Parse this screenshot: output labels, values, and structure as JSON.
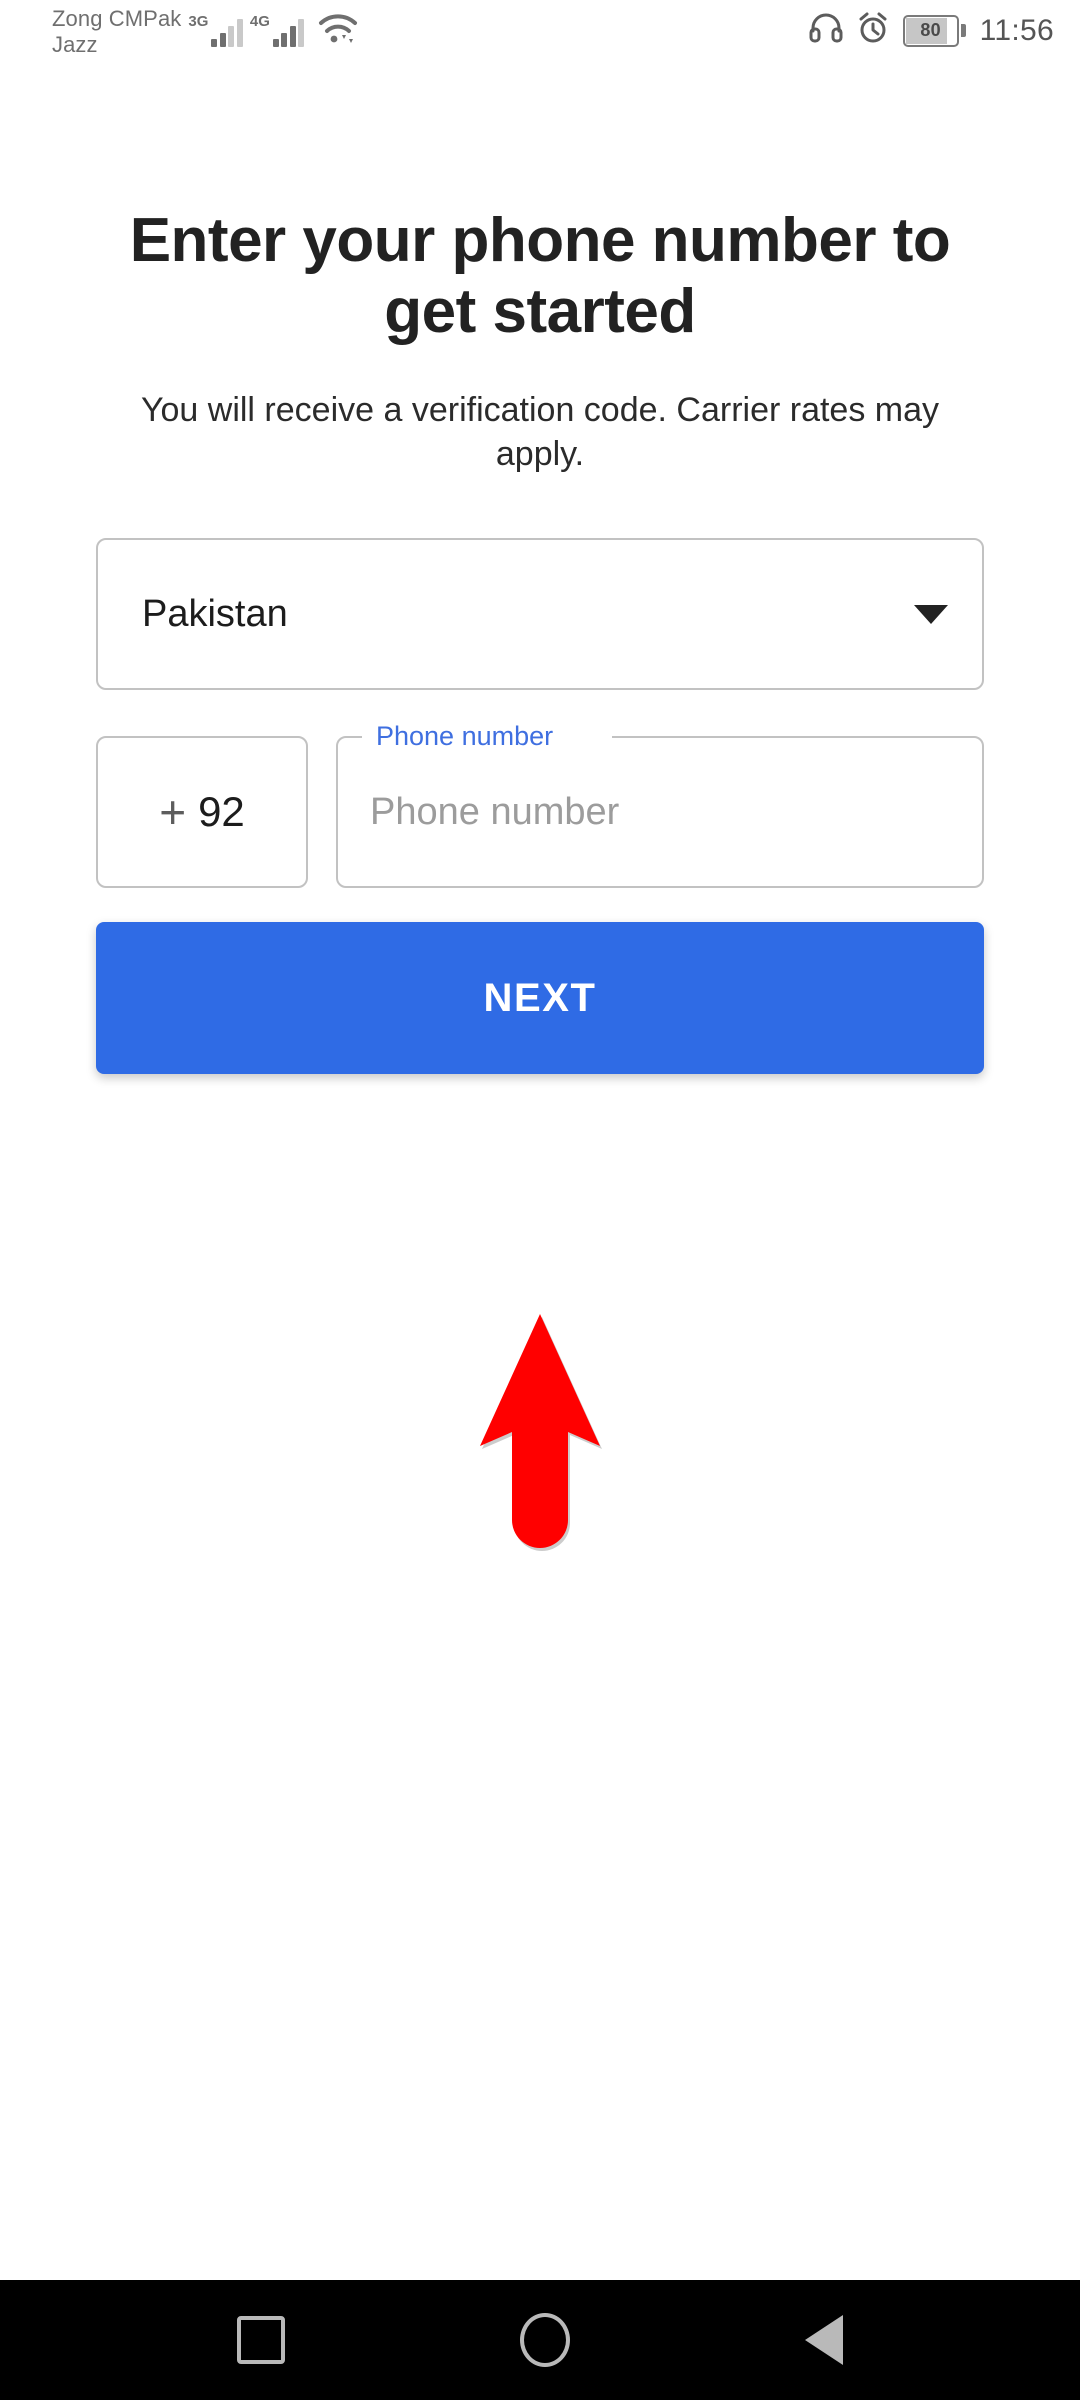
{
  "status_bar": {
    "carriers": [
      "Zong CMPak",
      "Jazz"
    ],
    "network_labels": [
      "3G",
      "4G"
    ],
    "wifi_icon": "wifi-icon",
    "headphone_icon": "headphone-icon",
    "alarm_icon": "alarm-clock-icon",
    "battery_level": "80",
    "time": "11:56"
  },
  "screen": {
    "title": "Enter your phone number to get started",
    "subtitle": "You will receive a verification code. Carrier rates may apply.",
    "country": {
      "selected": "Pakistan",
      "caret_icon": "chevron-down-icon"
    },
    "dial_code": {
      "plus": "+",
      "digits": "92"
    },
    "phone_field": {
      "label": "Phone number",
      "placeholder": "Phone number",
      "value": ""
    },
    "next_button": "NEXT"
  },
  "annotation": {
    "arrow_icon": "up-arrow-annotation",
    "color": "#ff0000"
  },
  "nav_bar": {
    "recents_icon": "square-recents-icon",
    "home_icon": "circle-home-icon",
    "back_icon": "triangle-back-icon"
  },
  "colors": {
    "accent_blue": "#2f6be5",
    "label_blue": "#3f6fe0",
    "annotation_red": "#ff0000",
    "border_gray": "#c2c2c2"
  }
}
